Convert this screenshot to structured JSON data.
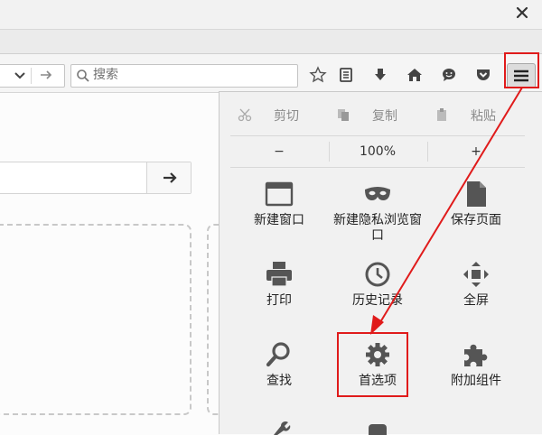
{
  "window": {
    "close_icon": "close-icon"
  },
  "search": {
    "placeholder": "搜索"
  },
  "menu": {
    "edit": {
      "cut": "剪切",
      "copy": "复制",
      "paste": "粘贴"
    },
    "zoom": {
      "minus": "−",
      "level": "100%",
      "plus": "+"
    },
    "items": [
      {
        "label": "新建窗口",
        "icon": "window-icon"
      },
      {
        "label": "新建隐私浏览窗口",
        "icon": "private-mask-icon"
      },
      {
        "label": "保存页面",
        "icon": "save-page-icon"
      },
      {
        "label": "打印",
        "icon": "print-icon"
      },
      {
        "label": "历史记录",
        "icon": "history-clock-icon"
      },
      {
        "label": "全屏",
        "icon": "fullscreen-icon"
      },
      {
        "label": "查找",
        "icon": "find-magnifier-icon"
      },
      {
        "label": "首选项",
        "icon": "preferences-gear-icon"
      },
      {
        "label": "附加组件",
        "icon": "addons-puzzle-icon"
      }
    ]
  },
  "annotation": {
    "highlight_color": "#e01b1b"
  }
}
